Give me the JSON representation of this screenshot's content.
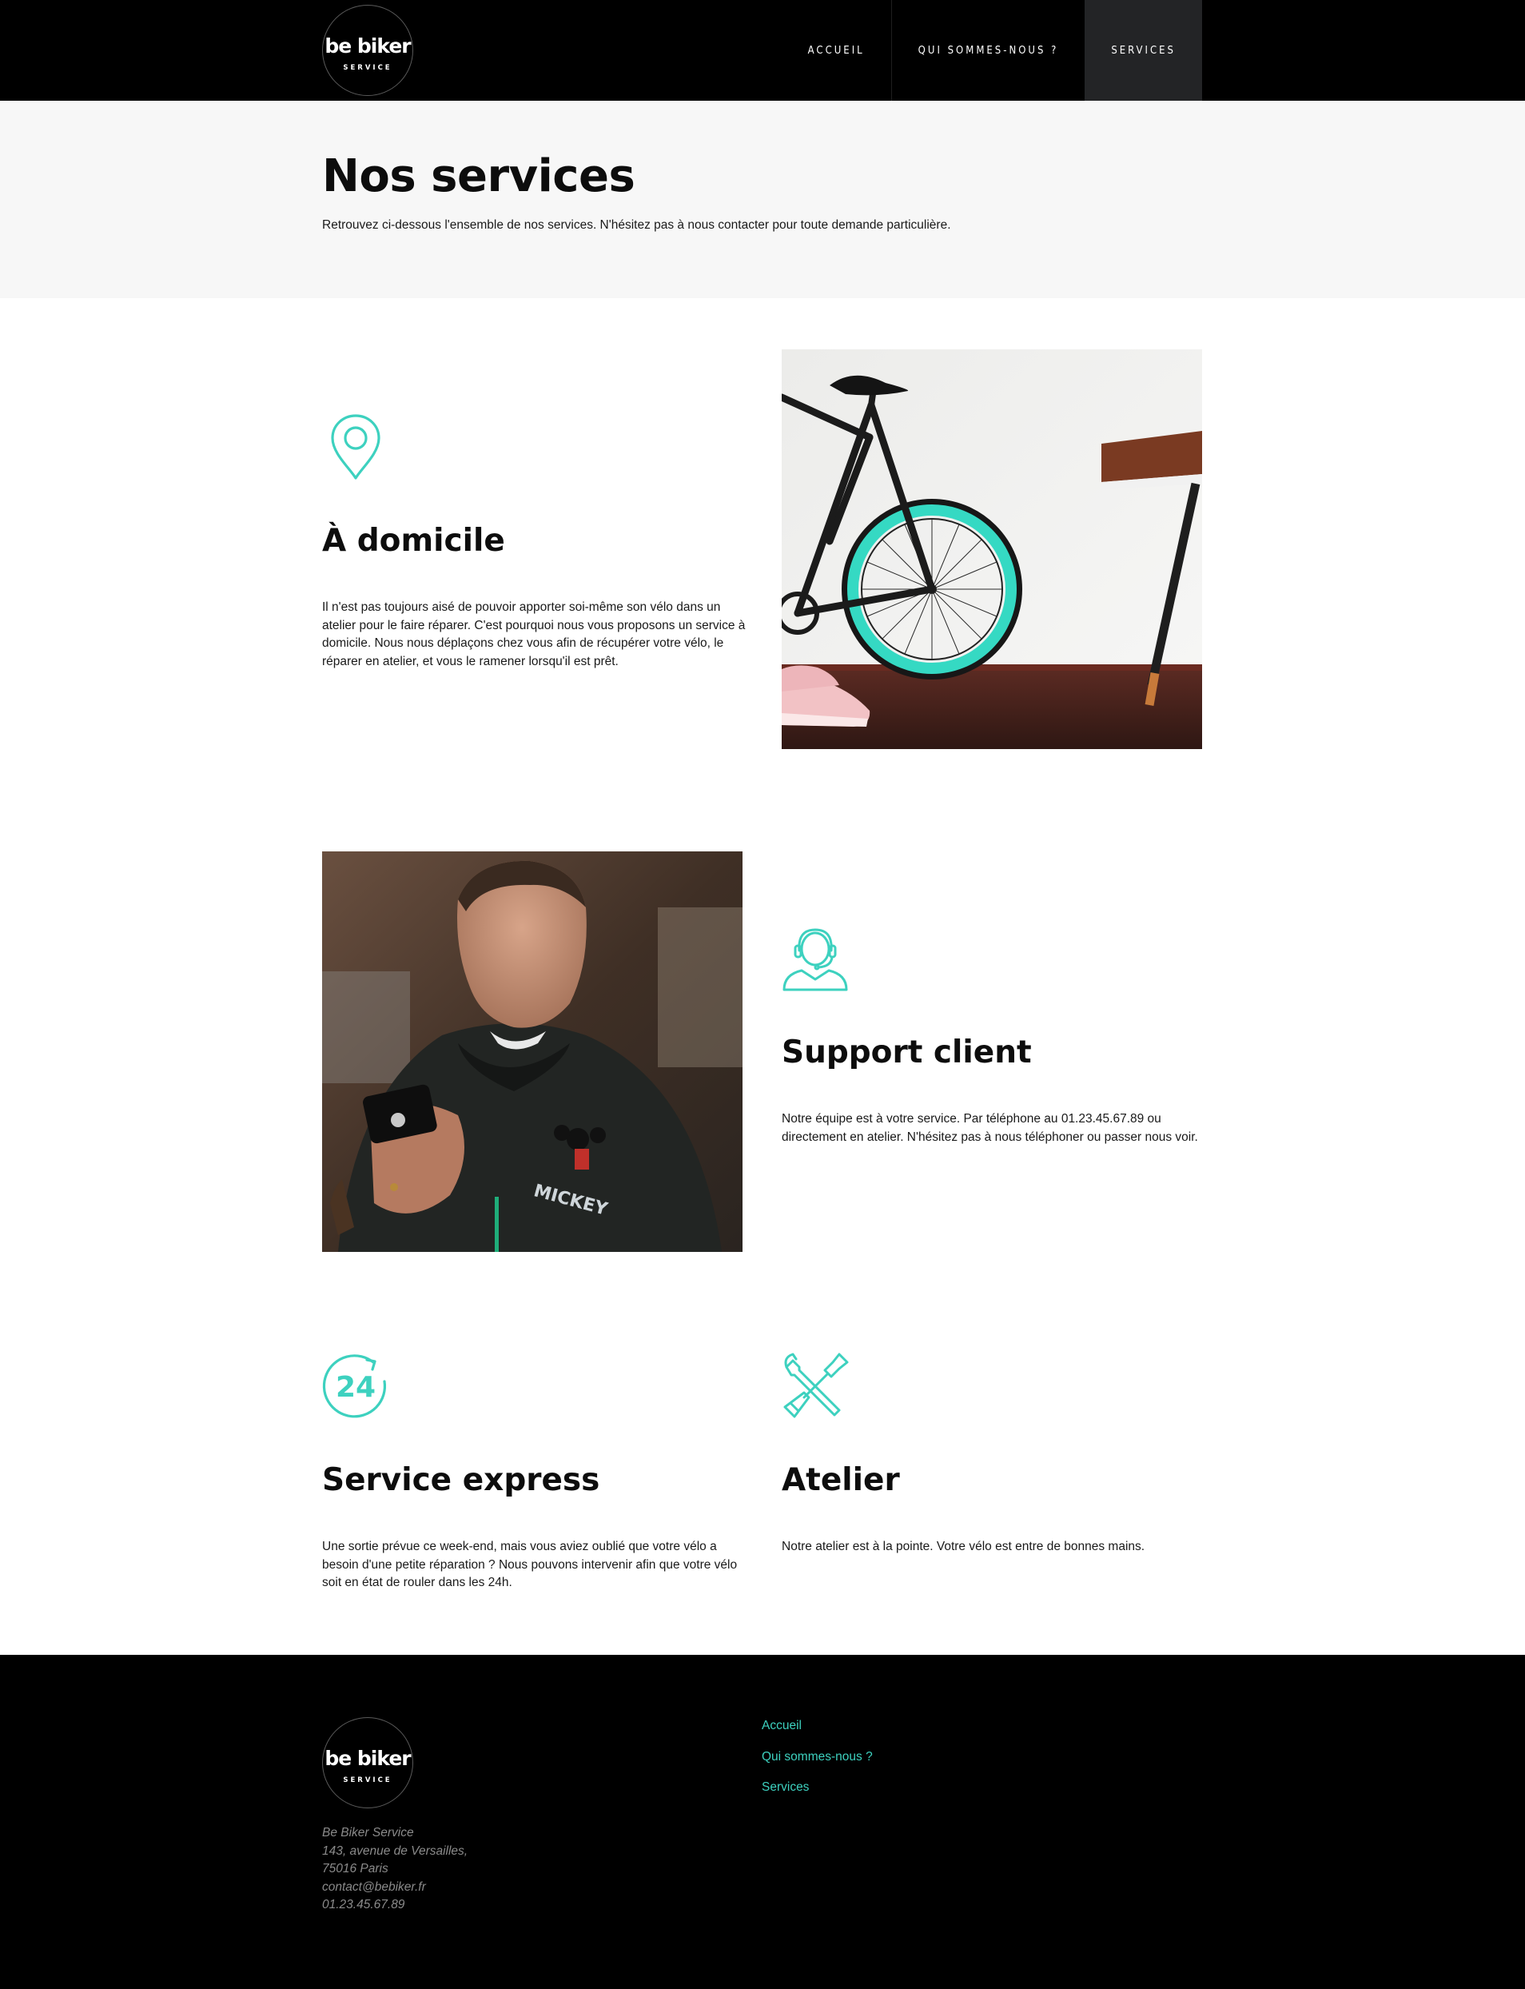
{
  "header": {
    "logo": {
      "brand": "be biker",
      "sub": "SERVICE"
    },
    "nav": [
      {
        "label": "ACCUEIL"
      },
      {
        "label": "QUI SOMMES-NOUS ?"
      },
      {
        "label": "SERVICES"
      }
    ]
  },
  "hero": {
    "title": "Nos services",
    "subtitle": "Retrouvez ci-dessous l'ensemble de nos services. N'hésitez pas à nous contacter pour toute demande particulière."
  },
  "services": {
    "domicile": {
      "icon": "location-pin-icon",
      "title": "À domicile",
      "text": "Il n'est pas toujours aisé de pouvoir apporter soi-même son vélo dans un atelier pour le faire réparer. C'est pourquoi nous vous proposons un service à domicile. Nous nous déplaçons chez vous afin de récupérer votre vélo, le réparer en atelier, et vous le ramener lorsqu'il est prêt."
    },
    "support": {
      "icon": "headset-icon",
      "title": "Support client",
      "text": "Notre équipe est à votre service. Par téléphone au 01.23.45.67.89 ou directement en atelier. N'hésitez pas à nous téléphoner ou passer nous voir."
    },
    "express": {
      "icon": "24h-icon",
      "icon_text": "24",
      "title": "Service express",
      "text": "Une sortie prévue ce week-end, mais vous aviez oublié que votre vélo a besoin d'une petite réparation ? Nous pouvons intervenir afin que votre vélo soit en état de rouler dans les 24h."
    },
    "atelier": {
      "icon": "tools-icon",
      "title": "Atelier",
      "text": "Notre atelier est à la pointe. Votre vélo est entre de bonnes mains."
    }
  },
  "footer": {
    "logo": {
      "brand": "be biker",
      "sub": "SERVICE"
    },
    "address": [
      "Be Biker Service",
      "143, avenue de Versailles,",
      "75016 Paris",
      "contact@bebiker.fr",
      "01.23.45.67.89"
    ],
    "links": [
      {
        "label": "Accueil"
      },
      {
        "label": "Qui sommes-nous ?"
      },
      {
        "label": "Services"
      }
    ]
  },
  "colors": {
    "accent": "#3dd1bf",
    "header_bg": "#000000",
    "hero_bg": "#f7f7f7",
    "nav_active_bg": "#232426"
  }
}
